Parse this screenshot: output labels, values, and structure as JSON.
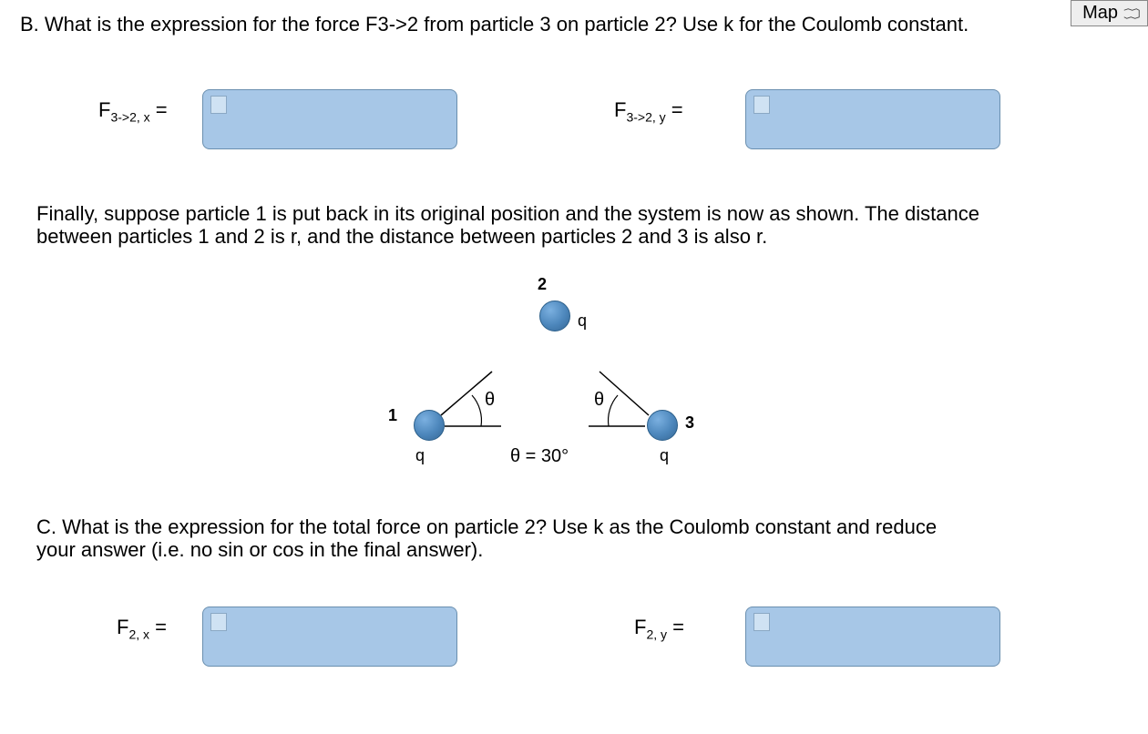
{
  "map_button": "Map",
  "partB": {
    "prompt": "B. What is the expression for the force F3->2 from particle 3 on particle 2? Use k for the Coulomb constant.",
    "lhs_x_html": "F<span class='sub'>3-&gt;2, x</span> =",
    "lhs_y_html": "F<span class='sub'>3-&gt;2, y</span> ="
  },
  "middle_text": "Finally, suppose particle 1 is put back in its original position and the system is now as shown. The distance between particles 1 and 2 is r, and the distance between particles 2 and 3 is also r.",
  "diagram": {
    "p1": "1",
    "p2": "2",
    "p3": "3",
    "q": "q",
    "theta": "θ",
    "angle_text": "θ = 30°"
  },
  "partC": {
    "prompt": "C. What is the expression for the total force on particle 2? Use k as the Coulomb constant and reduce your answer (i.e. no sin or cos in the final answer).",
    "lhs_x_html": "F<span class='sub'>2, x</span> =",
    "lhs_y_html": "F<span class='sub'>2, y</span> ="
  }
}
